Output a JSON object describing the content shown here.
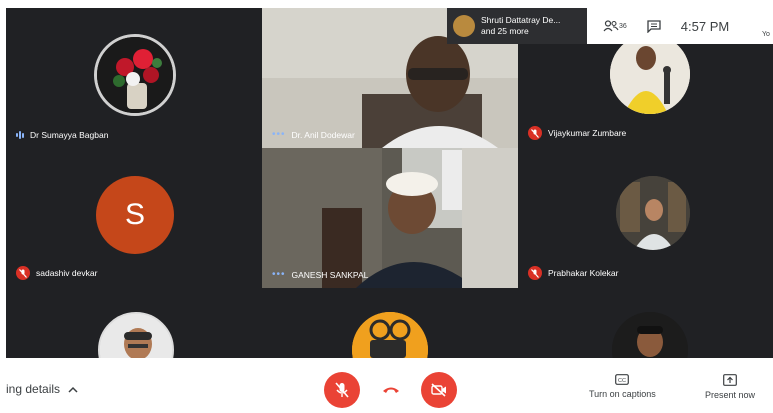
{
  "participants": {
    "p1": {
      "name": "Dr Sumayya Bagban",
      "mic": "speaking"
    },
    "p2": {
      "name": "Dr. Anil Dodewar",
      "mic": "active"
    },
    "p3": {
      "name": "Vijaykumar Zumbare",
      "mic": "muted"
    },
    "p4": {
      "name": "sadashiv devkar",
      "mic": "muted",
      "initial": "S",
      "avatar_color": "#c5471a"
    },
    "p5": {
      "name": "GANESH SANKPAL",
      "mic": "active"
    },
    "p6": {
      "name": "Prabhakar Kolekar",
      "mic": "muted"
    }
  },
  "notification": {
    "line1": "Shruti Dattatray De...",
    "line2": "and 25 more"
  },
  "header": {
    "people_count": "36",
    "time": "4:57 PM",
    "cut_text": "Yo"
  },
  "bottom": {
    "details_label": "ing details",
    "captions_label": "Turn on captions",
    "present_label": "Present now"
  },
  "colors": {
    "stage": "#202124",
    "tile": "#3c4043",
    "danger": "#ea4335",
    "accent": "#8ab4f8"
  }
}
